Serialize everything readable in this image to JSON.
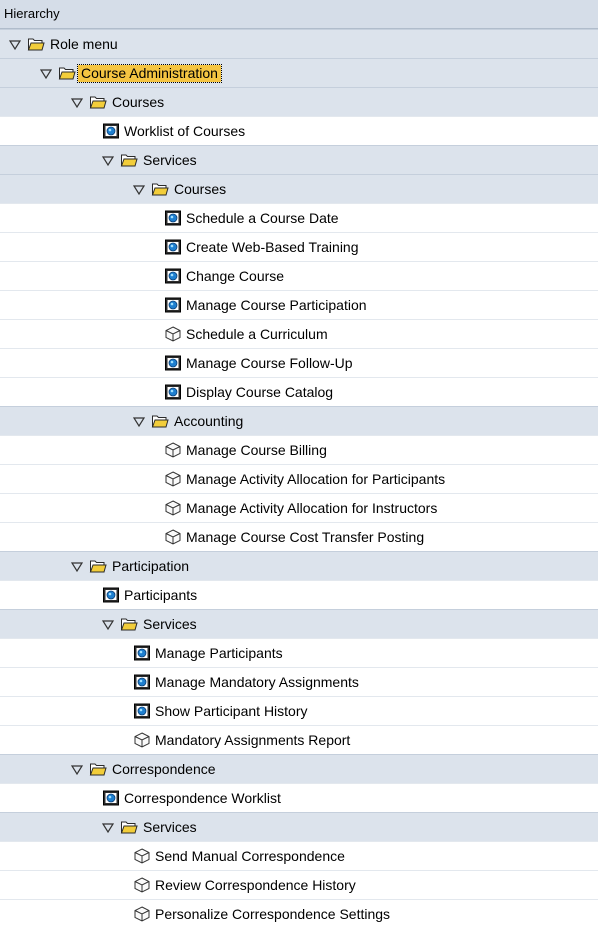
{
  "header": {
    "title": "Hierarchy"
  },
  "rows": [
    {
      "label": "Role menu",
      "level": 0,
      "type": "folder"
    },
    {
      "label": "Course Administration",
      "level": 1,
      "type": "folder",
      "selected": true
    },
    {
      "label": "Courses",
      "level": 2,
      "type": "folder"
    },
    {
      "label": "Worklist of Courses",
      "level": 3,
      "type": "transaction"
    },
    {
      "label": "Services",
      "level": 3,
      "type": "folder"
    },
    {
      "label": "Courses",
      "level": 4,
      "type": "folder"
    },
    {
      "label": "Schedule a Course Date",
      "level": 5,
      "type": "transaction"
    },
    {
      "label": "Create Web-Based Training",
      "level": 5,
      "type": "transaction"
    },
    {
      "label": "Change Course",
      "level": 5,
      "type": "transaction"
    },
    {
      "label": "Manage Course Participation",
      "level": 5,
      "type": "transaction"
    },
    {
      "label": "Schedule a Curriculum",
      "level": 5,
      "type": "cube"
    },
    {
      "label": "Manage Course Follow-Up",
      "level": 5,
      "type": "transaction"
    },
    {
      "label": "Display Course Catalog",
      "level": 5,
      "type": "transaction"
    },
    {
      "label": "Accounting",
      "level": 4,
      "type": "folder"
    },
    {
      "label": "Manage Course Billing",
      "level": 5,
      "type": "cube"
    },
    {
      "label": "Manage Activity Allocation for Participants",
      "level": 5,
      "type": "cube"
    },
    {
      "label": "Manage Activity Allocation for Instructors",
      "level": 5,
      "type": "cube"
    },
    {
      "label": "Manage Course Cost Transfer Posting",
      "level": 5,
      "type": "cube"
    },
    {
      "label": "Participation",
      "level": 2,
      "type": "folder"
    },
    {
      "label": "Participants",
      "level": 3,
      "type": "transaction"
    },
    {
      "label": "Services",
      "level": 3,
      "type": "folder"
    },
    {
      "label": "Manage Participants",
      "level": 4,
      "type": "transaction"
    },
    {
      "label": "Manage Mandatory Assignments",
      "level": 4,
      "type": "transaction"
    },
    {
      "label": "Show Participant History",
      "level": 4,
      "type": "transaction"
    },
    {
      "label": "Mandatory Assignments Report",
      "level": 4,
      "type": "cube"
    },
    {
      "label": "Correspondence",
      "level": 2,
      "type": "folder"
    },
    {
      "label": "Correspondence Worklist",
      "level": 3,
      "type": "transaction"
    },
    {
      "label": "Services",
      "level": 3,
      "type": "folder"
    },
    {
      "label": "Send Manual Correspondence",
      "level": 4,
      "type": "cube"
    },
    {
      "label": "Review Correspondence History",
      "level": 4,
      "type": "cube"
    },
    {
      "label": "Personalize Correspondence Settings",
      "level": 4,
      "type": "cube"
    }
  ]
}
